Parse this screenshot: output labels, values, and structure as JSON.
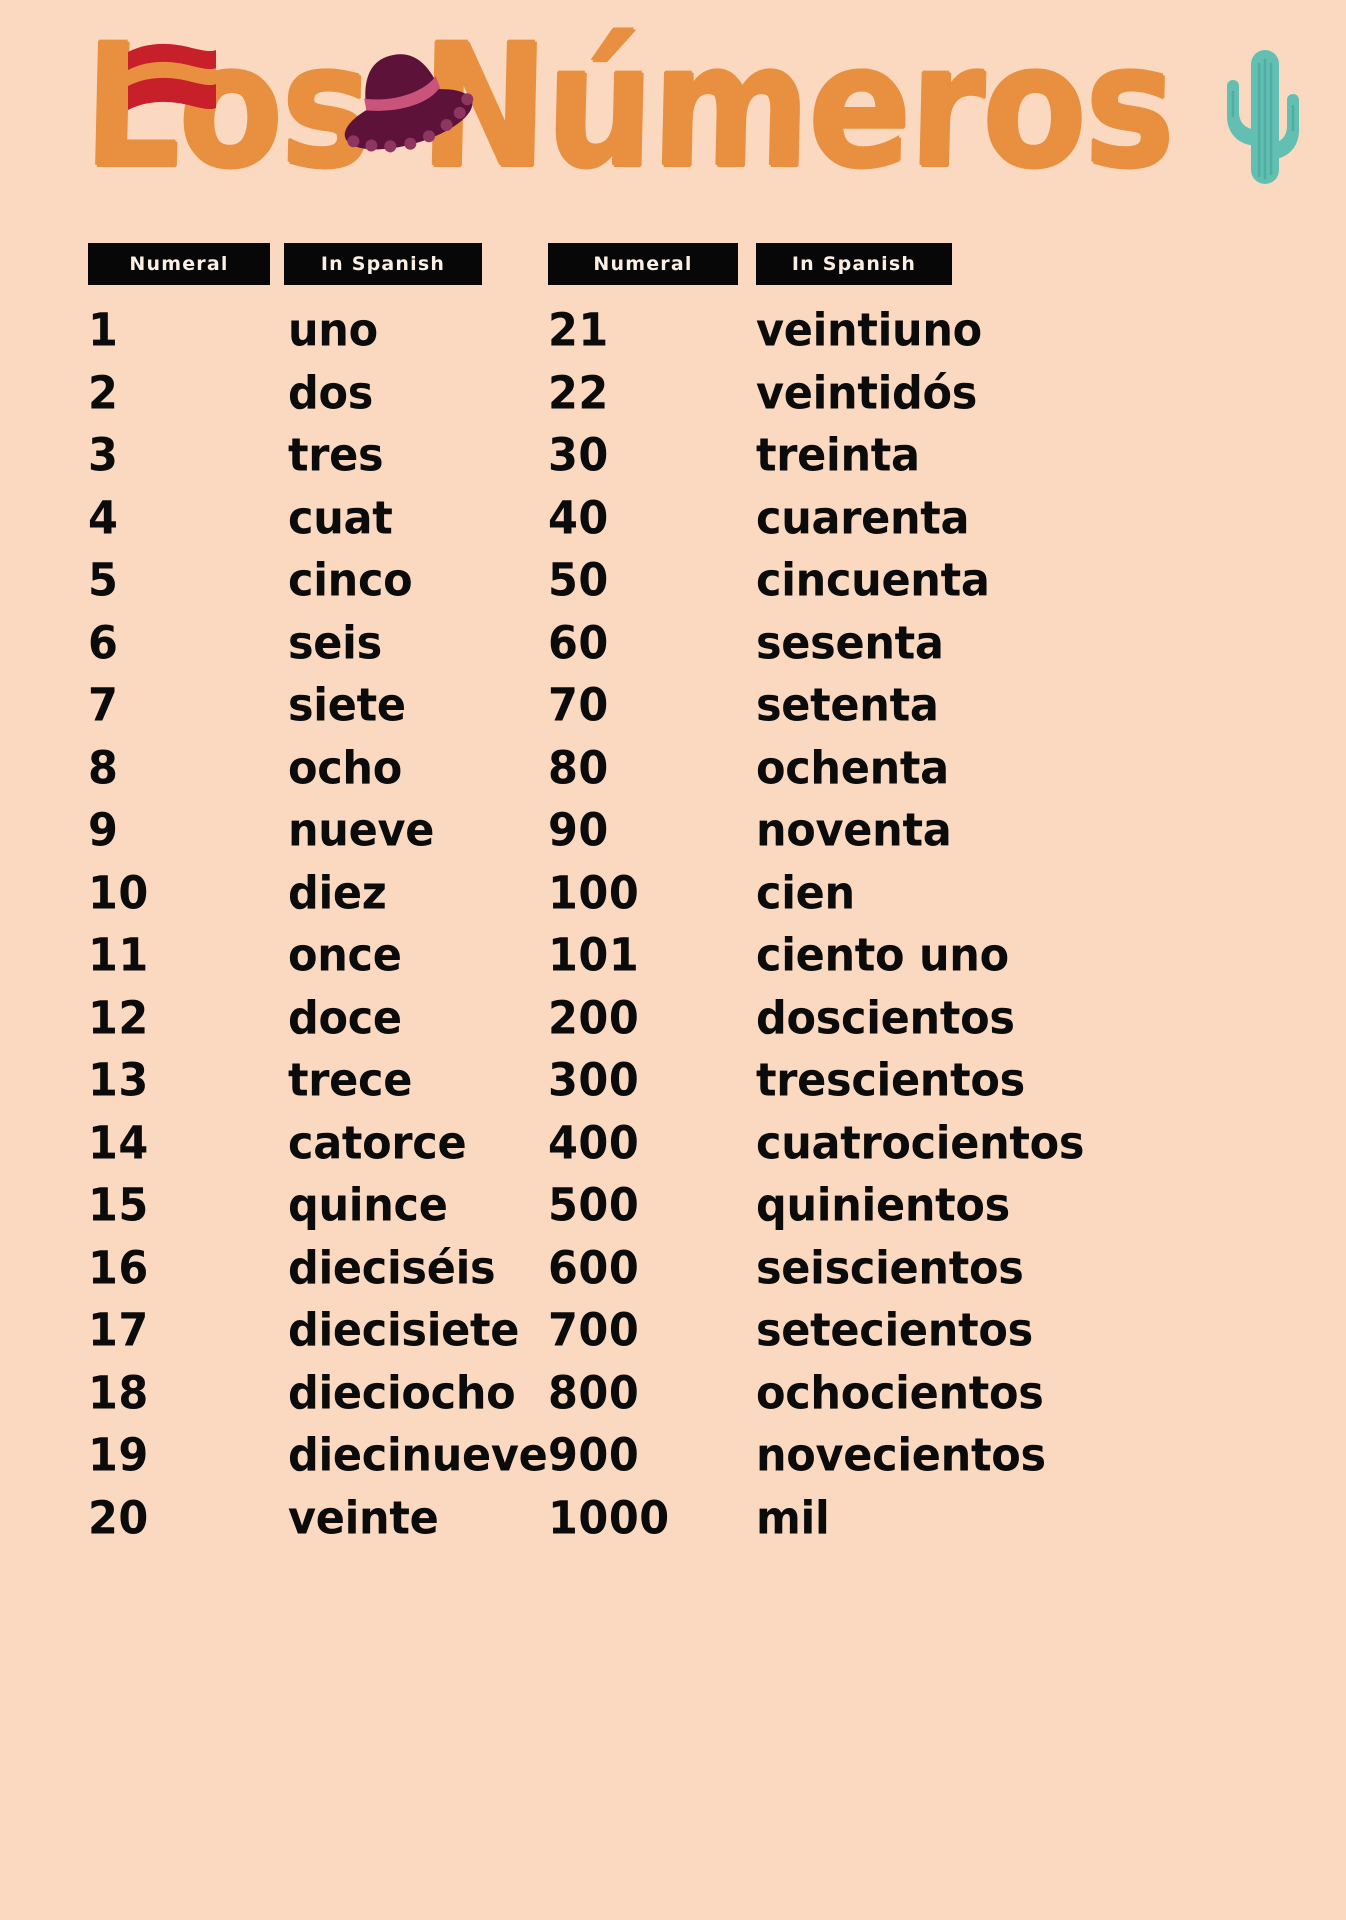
{
  "poster": {
    "title": "Los Números",
    "background_color": "#FAD9C0",
    "title_color": "#E8903F",
    "text_color": "#0B0B0B",
    "header_bg_color": "#070707",
    "header_text_color": "#FBEEE2"
  },
  "decorations": [
    {
      "name": "spanish-flag-icon",
      "colors": [
        "#C8202B",
        "#E8903F"
      ]
    },
    {
      "name": "sombrero-icon",
      "colors": [
        "#5C1239",
        "#C9537A",
        "#8E3560"
      ]
    },
    {
      "name": "cactus-icon",
      "colors": [
        "#62BFB2",
        "#4FAEA1"
      ]
    }
  ],
  "columns": {
    "numeral_header": "Numeral",
    "spanish_header": "In Spanish"
  },
  "table_left": {
    "headers": [
      "Numeral",
      "In Spanish"
    ],
    "rows": [
      {
        "numeral": "1",
        "spanish": "uno"
      },
      {
        "numeral": "2",
        "spanish": "dos"
      },
      {
        "numeral": "3",
        "spanish": "tres"
      },
      {
        "numeral": "4",
        "spanish": "cuat"
      },
      {
        "numeral": "5",
        "spanish": "cinco"
      },
      {
        "numeral": "6",
        "spanish": "seis"
      },
      {
        "numeral": "7",
        "spanish": "siete"
      },
      {
        "numeral": "8",
        "spanish": "ocho"
      },
      {
        "numeral": "9",
        "spanish": "nueve"
      },
      {
        "numeral": "10",
        "spanish": "diez"
      },
      {
        "numeral": "11",
        "spanish": "once"
      },
      {
        "numeral": "12",
        "spanish": "doce"
      },
      {
        "numeral": "13",
        "spanish": "trece"
      },
      {
        "numeral": "14",
        "spanish": "catorce"
      },
      {
        "numeral": "15",
        "spanish": "quince"
      },
      {
        "numeral": "16",
        "spanish": "dieciséis"
      },
      {
        "numeral": "17",
        "spanish": "diecisiete"
      },
      {
        "numeral": "18",
        "spanish": "dieciocho"
      },
      {
        "numeral": "19",
        "spanish": "diecinueve"
      },
      {
        "numeral": "20",
        "spanish": "veinte"
      }
    ]
  },
  "table_right": {
    "headers": [
      "Numeral",
      "In Spanish"
    ],
    "rows": [
      {
        "numeral": "21",
        "spanish": "veintiuno"
      },
      {
        "numeral": "22",
        "spanish": "veintidós"
      },
      {
        "numeral": "30",
        "spanish": "treinta"
      },
      {
        "numeral": "40",
        "spanish": "cuarenta"
      },
      {
        "numeral": "50",
        "spanish": "cincuenta"
      },
      {
        "numeral": "60",
        "spanish": "sesenta"
      },
      {
        "numeral": "70",
        "spanish": "setenta"
      },
      {
        "numeral": "80",
        "spanish": "ochenta"
      },
      {
        "numeral": "90",
        "spanish": "noventa"
      },
      {
        "numeral": "100",
        "spanish": "cien"
      },
      {
        "numeral": "101",
        "spanish": "ciento uno"
      },
      {
        "numeral": "200",
        "spanish": "doscientos"
      },
      {
        "numeral": "300",
        "spanish": "trescientos"
      },
      {
        "numeral": "400",
        "spanish": "cuatrocientos"
      },
      {
        "numeral": "500",
        "spanish": "quinientos"
      },
      {
        "numeral": "600",
        "spanish": "seiscientos"
      },
      {
        "numeral": "700",
        "spanish": "setecientos"
      },
      {
        "numeral": "800",
        "spanish": "ochocientos"
      },
      {
        "numeral": "900",
        "spanish": "novecientos"
      },
      {
        "numeral": "1000",
        "spanish": "mil"
      }
    ]
  }
}
